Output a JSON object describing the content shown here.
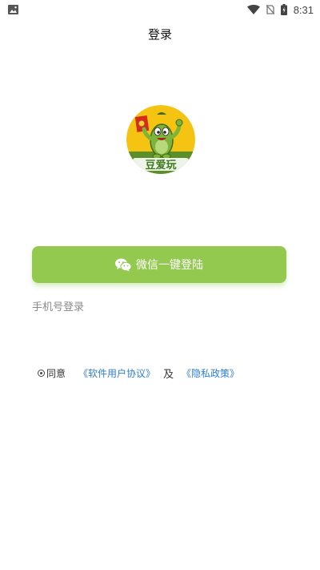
{
  "status_bar": {
    "time": "8:31",
    "left_icon": "image-icon",
    "right_icons": [
      "wifi-icon",
      "no-sim-icon",
      "battery-charging-icon"
    ]
  },
  "header": {
    "title": "登录"
  },
  "logo": {
    "text": "豆爱玩",
    "colors": {
      "background_top": "#f5c412",
      "background_bottom": "#5a8f2a"
    }
  },
  "login": {
    "wechat_label": "微信一键登陆",
    "wechat_icon": "wechat-icon",
    "phone_label": "手机号登录"
  },
  "agreement": {
    "agree_label": "同意",
    "user_agreement": "《软件用户协议》",
    "and_label": "及",
    "privacy_policy": "《隐私政策》"
  },
  "colors": {
    "primary_button": "#93c94f",
    "link": "#2e7fd6",
    "secondary_text": "#8a8a8a"
  }
}
